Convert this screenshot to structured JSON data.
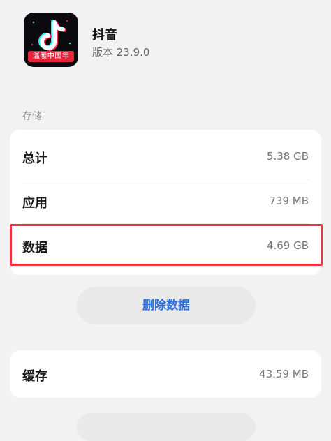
{
  "app": {
    "name": "抖音",
    "version": "版本 23.9.0",
    "icon_banner": "温暖中国年",
    "icon_name": "tiktok-logo-icon"
  },
  "storage": {
    "section_title": "存储",
    "rows": [
      {
        "label": "总计",
        "value": "5.38 GB"
      },
      {
        "label": "应用",
        "value": "739 MB"
      },
      {
        "label": "数据",
        "value": "4.69 GB"
      }
    ],
    "delete_button_label": "删除数据"
  },
  "cache": {
    "label": "缓存",
    "value": "43.59 MB"
  },
  "colors": {
    "accent_blue": "#2f6fe0",
    "highlight_red": "#e8353f",
    "background": "#f2f2f2"
  }
}
